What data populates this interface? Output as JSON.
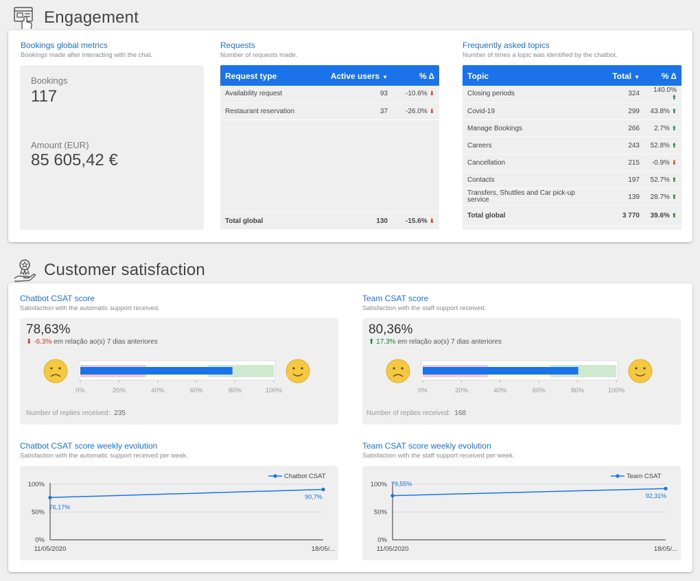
{
  "engagement": {
    "title": "Engagement",
    "bookings": {
      "title": "Bookings global metrics",
      "subtitle": "Bookings made after interacting with the chat.",
      "bookings_label": "Bookings",
      "bookings_value": "117",
      "amount_label": "Amount (EUR)",
      "amount_value": "85 605,42 €"
    },
    "requests": {
      "title": "Requests",
      "subtitle": "Number of requests made.",
      "columns": [
        "Request type",
        "Active users",
        "% Δ"
      ],
      "rows": [
        {
          "type": "Availability request",
          "users": "93",
          "delta": "-10.6%",
          "dir": "down"
        },
        {
          "type": "Restaurant reservation",
          "users": "37",
          "delta": "-26.0%",
          "dir": "down"
        }
      ],
      "total": {
        "label": "Total global",
        "users": "130",
        "delta": "-15.6%",
        "dir": "down"
      }
    },
    "topics": {
      "title": "Frequently asked topics",
      "subtitle": "Number of times a topic was identified by the chatbot.",
      "columns": [
        "Topic",
        "Total",
        "% Δ"
      ],
      "rows": [
        {
          "topic": "Closing periods",
          "total": "324",
          "delta": "140.0%",
          "dir": "up"
        },
        {
          "topic": "Covid-19",
          "total": "299",
          "delta": "43.8%",
          "dir": "up"
        },
        {
          "topic": "Manage Bookings",
          "total": "266",
          "delta": "2.7%",
          "dir": "up"
        },
        {
          "topic": "Careers",
          "total": "243",
          "delta": "52.8%",
          "dir": "up"
        },
        {
          "topic": "Cancellation",
          "total": "215",
          "delta": "-0.9%",
          "dir": "down"
        },
        {
          "topic": "Contacts",
          "total": "197",
          "delta": "52.7%",
          "dir": "up"
        },
        {
          "topic": "Transfers, Shuttles and Car pick-up service",
          "total": "139",
          "delta": "28.7%",
          "dir": "up"
        }
      ],
      "total": {
        "label": "Total global",
        "total": "3 770",
        "delta": "39.6%",
        "dir": "up"
      }
    }
  },
  "satisfaction": {
    "title": "Customer satisfaction",
    "chatbot": {
      "title": "Chatbot CSAT score",
      "subtitle": "Satisfaction with the automatic support received.",
      "score": "78,63%",
      "delta": "-6.3%",
      "delta_dir": "down",
      "delta_text": "em relação ao(s) 7 dias anteriores",
      "bar_value": 78.63,
      "replies_label": "Number of replies received:",
      "replies_value": "235"
    },
    "team": {
      "title": "Team CSAT score",
      "subtitle": "Satisfaction with the staff support received.",
      "score": "80,36%",
      "delta": "17.3%",
      "delta_dir": "up",
      "delta_text": "em relação ao(s) 7 dias anteriores",
      "bar_value": 80.36,
      "replies_label": "Number of replies received:",
      "replies_value": "168"
    },
    "bullet_ticks": [
      "0%",
      "20%",
      "40%",
      "60%",
      "80%",
      "100%"
    ],
    "chatbot_weekly": {
      "title": "Chatbot CSAT score weekly evolution",
      "subtitle": "Satisfaction with the automatic support received per week."
    },
    "team_weekly": {
      "title": "Team CSAT score weekly evolution",
      "subtitle": "Satisfaction with the staff support received per week."
    }
  },
  "colors": {
    "accent": "#1a73e8",
    "negative": "#d93025",
    "positive": "#188038",
    "smiley": "#f5c842"
  },
  "icons": {
    "engagement": "chat-window-hand-icon",
    "satisfaction": "award-hand-icon",
    "sad": "sad-face-icon",
    "happy": "happy-face-icon"
  },
  "chart_data": [
    {
      "type": "line",
      "series": [
        {
          "name": "Chatbot CSAT",
          "values": [
            76.17,
            90.7
          ],
          "labels": [
            "76,17%",
            "90,7%"
          ]
        }
      ],
      "x": [
        "11/05/2020",
        "18/05/..."
      ],
      "yticks": [
        "0%",
        "50%",
        "100%"
      ],
      "ylim": [
        0,
        100
      ],
      "legend": "top-right",
      "grid": true
    },
    {
      "type": "line",
      "series": [
        {
          "name": "Team CSAT",
          "values": [
            79.55,
            92.31
          ],
          "labels": [
            "79,55%",
            "92,31%"
          ]
        }
      ],
      "x": [
        "11/05/2020",
        "18/05/..."
      ],
      "yticks": [
        "0%",
        "50%",
        "100%"
      ],
      "ylim": [
        0,
        100
      ],
      "legend": "top-right",
      "grid": true
    }
  ]
}
